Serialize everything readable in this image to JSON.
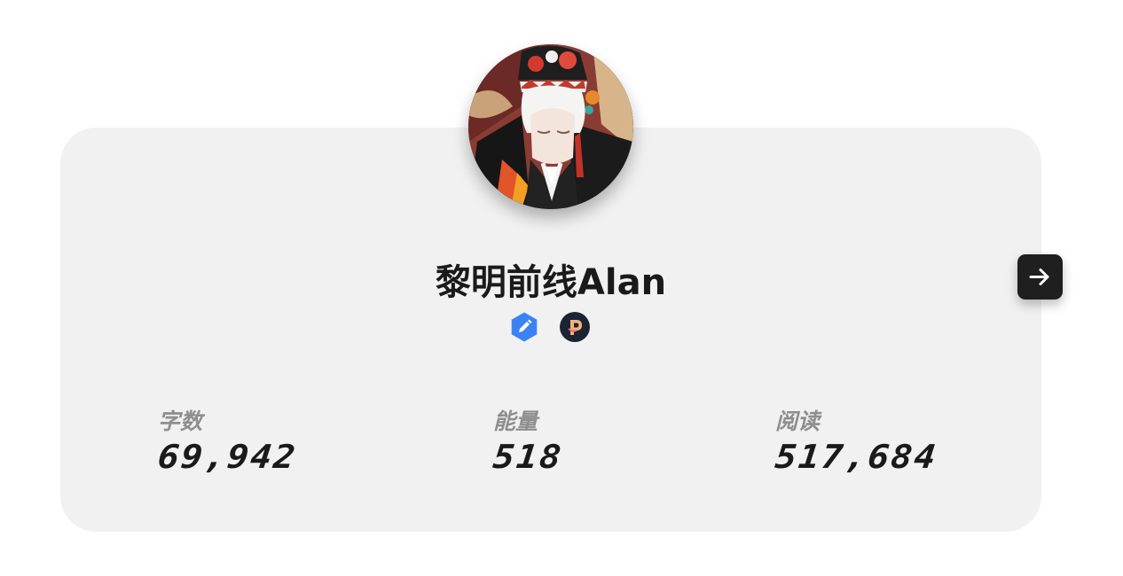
{
  "profile": {
    "username": "黎明前线Alan",
    "avatar_icon": "avatar-illustration",
    "badges": [
      {
        "icon": "pencil-hexagon-icon",
        "color": "#3b82f6"
      },
      {
        "icon": "p-coin-icon",
        "color": "#1c2333"
      }
    ]
  },
  "stats": [
    {
      "label": "字数",
      "value": "69,942"
    },
    {
      "label": "能量",
      "value": "518"
    },
    {
      "label": "阅读",
      "value": "517,684"
    }
  ],
  "next_button": {
    "icon": "arrow-right-icon"
  },
  "colors": {
    "card_bg": "#f1f1f1",
    "accent_blue": "#3b82f6",
    "dark_button": "#1f1f1f",
    "label_gray": "#8e8e8e"
  }
}
